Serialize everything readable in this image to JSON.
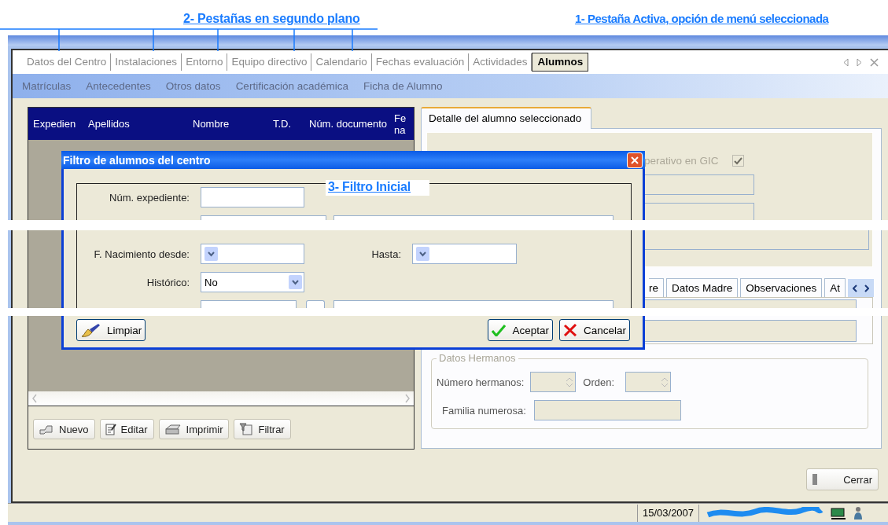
{
  "annotations": [
    {
      "text": "2- Pestañas en segundo plano"
    },
    {
      "text": "1- Pestaña Activa, opción de menú seleccionada"
    },
    {
      "text": "3- Filtro Inicial"
    }
  ],
  "tabs": [
    {
      "label": "Datos del Centro",
      "selected": false
    },
    {
      "label": "Instalaciones",
      "selected": false
    },
    {
      "label": "Entorno",
      "selected": false
    },
    {
      "label": "Equipo directivo",
      "selected": false
    },
    {
      "label": "Calendario",
      "selected": false
    },
    {
      "label": "Fechas evaluación",
      "selected": false
    },
    {
      "label": "Actividades",
      "selected": false
    },
    {
      "label": "Alumnos",
      "selected": true
    }
  ],
  "submenu": [
    {
      "label": "Matrículas"
    },
    {
      "label": "Antecedentes"
    },
    {
      "label": "Otros datos"
    },
    {
      "label": "Certificación académica"
    },
    {
      "label": "Ficha de Alumno"
    }
  ],
  "students_table": {
    "columns": [
      "Expedien",
      "Apellidos",
      "Nombre",
      "T.D.",
      "Núm. documento",
      "Fe na"
    ]
  },
  "toolbar": [
    {
      "label": "Nuevo",
      "kind": "new"
    },
    {
      "label": "Editar",
      "kind": "edit"
    },
    {
      "label": "Imprimir",
      "kind": "print"
    },
    {
      "label": "Filtrar",
      "kind": "filter"
    }
  ],
  "detail_tabs": [
    {
      "label": "Detalle del alumno seleccionado",
      "selected": true
    }
  ],
  "detail": {
    "operative": {
      "label": "perativo en GIC",
      "checked": true
    },
    "subtabs": [
      {
        "label": "re"
      },
      {
        "label": "Datos Madre"
      },
      {
        "label": "Observaciones"
      },
      {
        "label": "At"
      }
    ],
    "siblings": {
      "title": "Datos Hermanos",
      "number_label": "Número hermanos:",
      "order_label": "Orden:",
      "large_family_label": "Familia numerosa:"
    }
  },
  "close_button": "Cerrar",
  "dialog": {
    "title": "Filtro de alumnos del centro",
    "record_label": "Núm. expediente:",
    "birth_from_label": "F. Nacimiento desde:",
    "birth_to_label": "Hasta:",
    "historic_label": "Histórico:",
    "historic_value": "No",
    "buttons": [
      {
        "label": "Limpiar",
        "kind": "clear"
      },
      {
        "label": "Aceptar",
        "kind": "accept"
      },
      {
        "label": "Cancelar",
        "kind": "cancel"
      }
    ]
  },
  "status_bar": {
    "date": "15/03/2007"
  }
}
